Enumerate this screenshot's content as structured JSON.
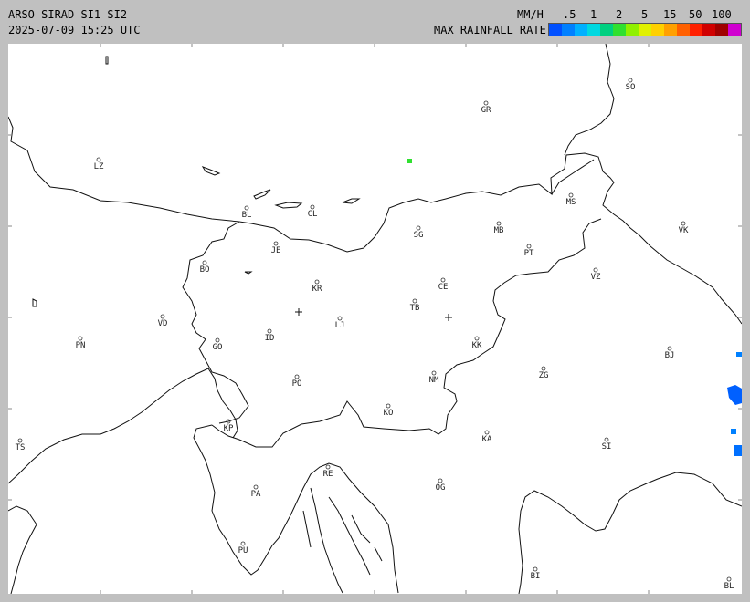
{
  "header": {
    "title_line1": "ARSO SIRAD SI1 SI2",
    "title_line2": "2025-07-09 15:25 UTC",
    "units": "MM/H",
    "legend_label": "MAX RAINFALL RATE"
  },
  "legend": {
    "ticks": [
      ".5",
      "1",
      "2",
      "5",
      "15",
      "50",
      "100"
    ],
    "colors": [
      "#0050ff",
      "#0080ff",
      "#00b0ff",
      "#00d8e0",
      "#00d080",
      "#30e030",
      "#90f000",
      "#e0f000",
      "#ffd000",
      "#ffa000",
      "#ff6000",
      "#ff2000",
      "#d00000",
      "#a00000",
      "#d000d0"
    ]
  },
  "places": [
    {
      "code": "SO"
    },
    {
      "code": "GR"
    },
    {
      "code": "LZ"
    },
    {
      "code": "MS"
    },
    {
      "code": "BL"
    },
    {
      "code": "CL"
    },
    {
      "code": "MB"
    },
    {
      "code": "VK"
    },
    {
      "code": "SG"
    },
    {
      "code": "JE"
    },
    {
      "code": "PT"
    },
    {
      "code": "BO"
    },
    {
      "code": "KR"
    },
    {
      "code": "CE"
    },
    {
      "code": "VZ"
    },
    {
      "code": "TB"
    },
    {
      "code": "VD"
    },
    {
      "code": "LJ"
    },
    {
      "code": "PN"
    },
    {
      "code": "ID"
    },
    {
      "code": "GO"
    },
    {
      "code": "KK"
    },
    {
      "code": "BJ"
    },
    {
      "code": "ZG"
    },
    {
      "code": "PO"
    },
    {
      "code": "NM"
    },
    {
      "code": "KO"
    },
    {
      "code": "KP"
    },
    {
      "code": "KA"
    },
    {
      "code": "TS"
    },
    {
      "code": "SI"
    },
    {
      "code": "RE"
    },
    {
      "code": "PA"
    },
    {
      "code": "OG"
    },
    {
      "code": "PU"
    },
    {
      "code": "BI"
    },
    {
      "code": "BL"
    }
  ]
}
